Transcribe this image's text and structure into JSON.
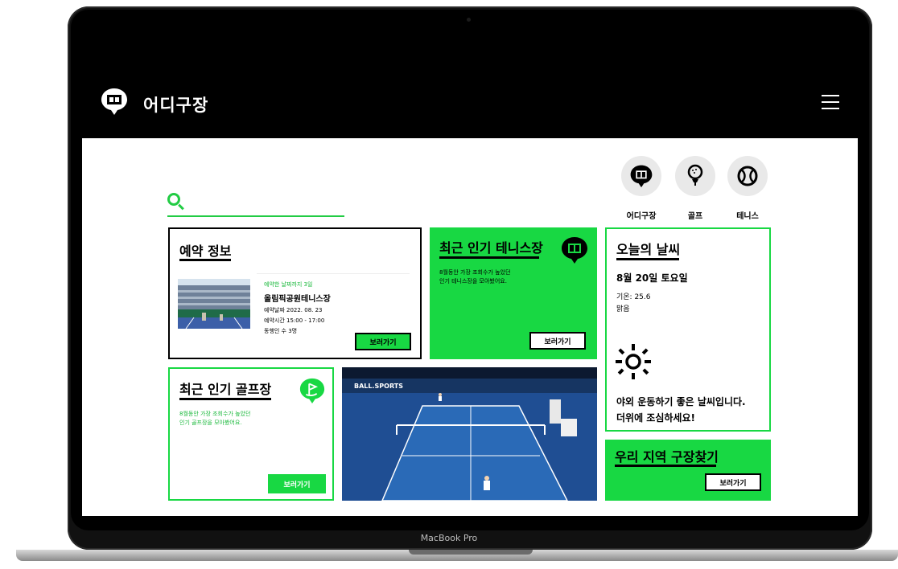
{
  "app": {
    "brand": "어디구장",
    "footer_label": "MacBook Pro"
  },
  "categories": [
    {
      "name": "어디구장",
      "icon": "court-pin-icon"
    },
    {
      "name": "골프",
      "icon": "golf-icon"
    },
    {
      "name": "테니스",
      "icon": "tennis-ball-icon"
    }
  ],
  "reservation": {
    "title": "예약 정보",
    "dday": "예약한 날짜까지 3일",
    "venue": "올림픽공원테니스장",
    "date_label": "예약날짜 2022. 08. 23",
    "time_label": "예약시간 15:00 - 17:00",
    "people_label": "동행인 수 3명",
    "button": "보러가기"
  },
  "tennis_popular": {
    "title": "최근 인기 테니스장",
    "desc_line1": "8월동안 가장 조회수가 높았던",
    "desc_line2": "인기 테니스장을 모아봤어요.",
    "button": "보러가기"
  },
  "weather": {
    "title": "오늘의 날씨",
    "date": "8월 20일 토요일",
    "temp": "기온: 25.6",
    "condition": "맑음",
    "message_line1": "야외 운동하기 좋은 날씨입니다.",
    "message_line2": "더위에 조심하세요!"
  },
  "golf_popular": {
    "title": "최근 인기 골프장",
    "desc_line1": "8월동안 가장 조회수가 높았던",
    "desc_line2": "인기 골프장을 모아봤어요.",
    "button": "보러가기"
  },
  "local": {
    "title": "우리 지역 구장찾기",
    "button": "보러가기"
  },
  "photo_caption": "BALL.SPORTS"
}
